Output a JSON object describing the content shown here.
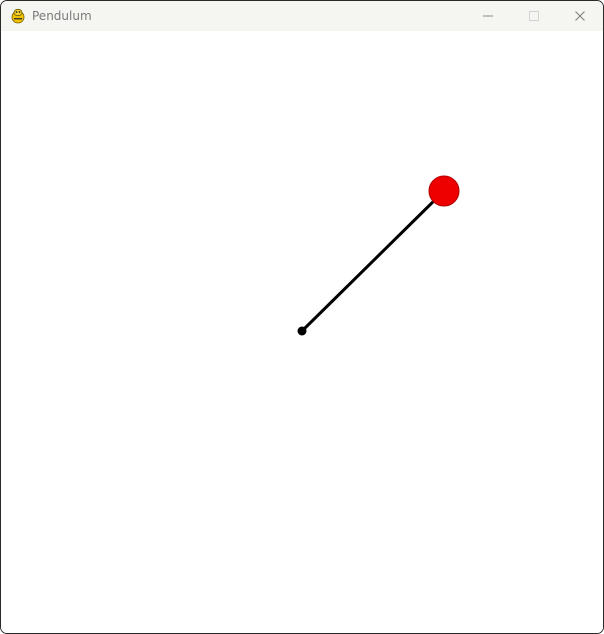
{
  "window": {
    "title": "Pendulum",
    "app_icon": "pygame-snake-icon",
    "controls": [
      "minimize-icon",
      "maximize-icon",
      "close-icon"
    ]
  },
  "scene": {
    "background_color": "#ffffff",
    "rod_color": "#000000",
    "pivot_color": "#000000",
    "bob_color": "#ee0000"
  }
}
